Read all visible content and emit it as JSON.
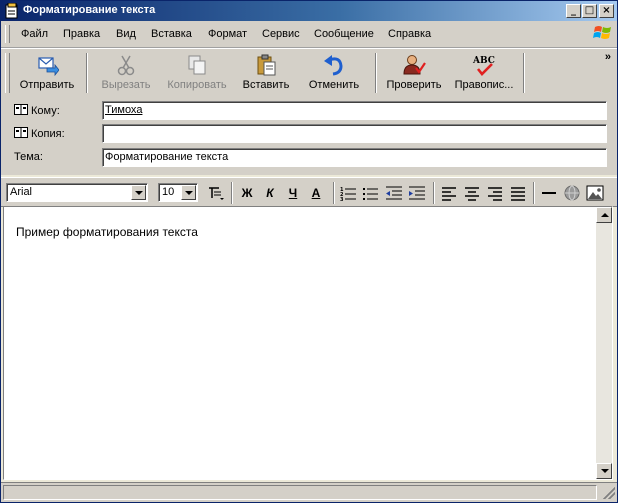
{
  "window": {
    "title": "Форматирование текста",
    "controls": {
      "minimize": "_",
      "maximize": "□",
      "close": "×"
    }
  },
  "menu": {
    "items": [
      {
        "label": "Файл",
        "name": "menu-file"
      },
      {
        "label": "Правка",
        "name": "menu-edit"
      },
      {
        "label": "Вид",
        "name": "menu-view"
      },
      {
        "label": "Вставка",
        "name": "menu-insert"
      },
      {
        "label": "Формат",
        "name": "menu-format"
      },
      {
        "label": "Сервис",
        "name": "menu-tools"
      },
      {
        "label": "Сообщение",
        "name": "menu-message"
      },
      {
        "label": "Справка",
        "name": "menu-help"
      }
    ]
  },
  "toolbar": {
    "send_label": "Отправить",
    "cut_label": "Вырезать",
    "copy_label": "Копировать",
    "paste_label": "Вставить",
    "undo_label": "Отменить",
    "check_label": "Проверить",
    "spelling_label": "Правопис...",
    "more_label": "»"
  },
  "header": {
    "to_label": "Кому:",
    "to_value": "Тимоха",
    "cc_label": "Копия:",
    "cc_value": "",
    "subject_label": "Тема:",
    "subject_value": "Форматирование текста"
  },
  "format": {
    "font_name": "Arial",
    "font_size": "10",
    "bold_label": "Ж",
    "italic_label": "К",
    "underline_label": "Ч",
    "color_label": "A"
  },
  "editor": {
    "body_text": "Пример форматирования текста"
  },
  "colors": {
    "title_start": "#0a246a",
    "title_end": "#a6caf0",
    "face": "#d4d0c8"
  }
}
